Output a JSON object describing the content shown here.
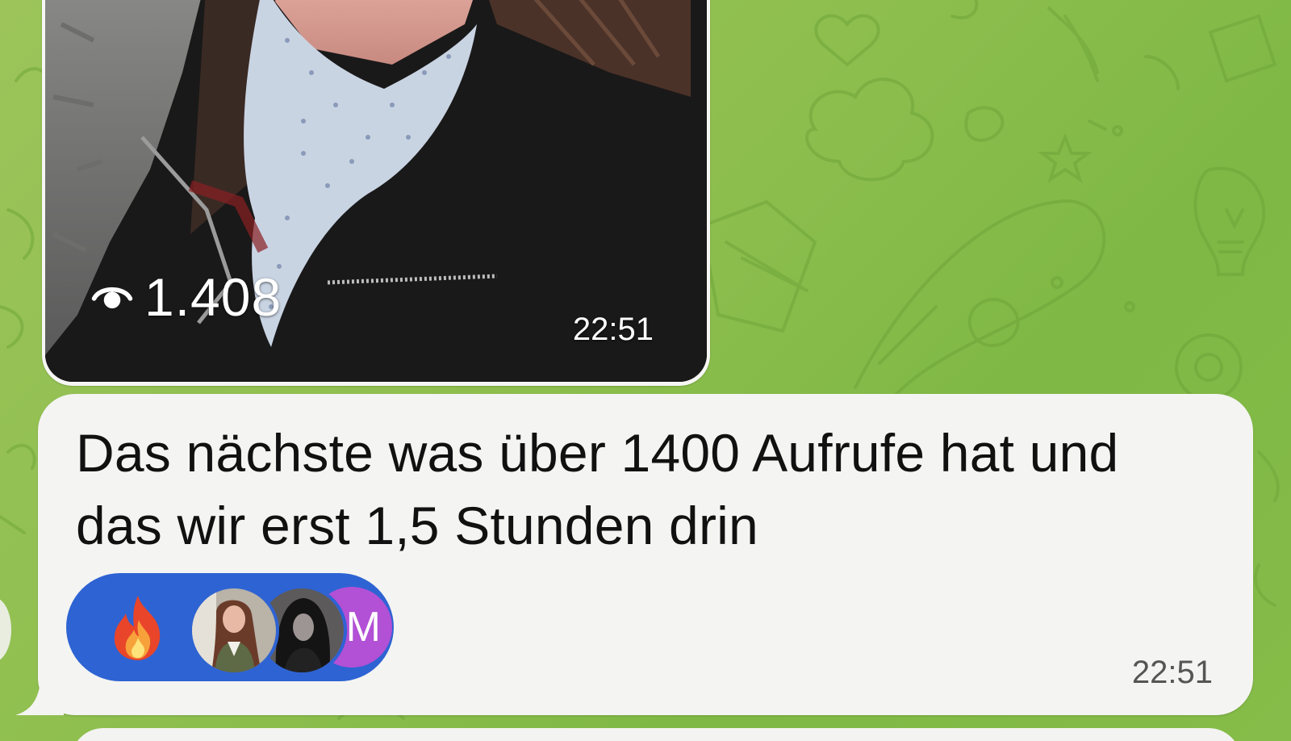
{
  "photo_message": {
    "views": "1.408",
    "time": "22:51",
    "icon": "eye-icon"
  },
  "text_message": {
    "line1": "Das nächste was über 1400 Aufrufe hat und",
    "line2": "das wir erst 1,5 Stunden drin",
    "time": "22:51",
    "reaction": {
      "emoji": "fire-emoji",
      "avatar_initial": "M",
      "pill_color": "#2e63d3",
      "initial_avatar_color": "#b250d6"
    }
  },
  "colors": {
    "background": "#8fbf4f",
    "bubble": "#f4f4f2"
  }
}
